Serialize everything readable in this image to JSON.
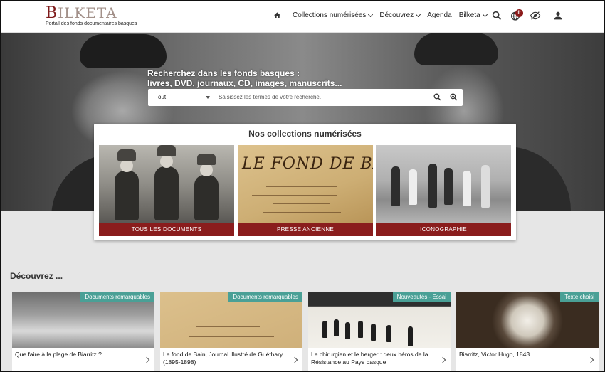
{
  "header": {
    "logo_word_initial": "B",
    "logo_word_rest": "ILKETA",
    "logo_subtitle": "Portail des fonds documentaires basques",
    "nav": [
      {
        "label": "Collections numérisées",
        "has_dropdown": true
      },
      {
        "label": "Découvrez",
        "has_dropdown": true
      },
      {
        "label": "Agenda",
        "has_dropdown": false
      },
      {
        "label": "Bilketa",
        "has_dropdown": true
      }
    ],
    "language_badge": "fr",
    "icons": [
      "home-icon",
      "search-icon",
      "globe-icon",
      "accessibility-eye-icon",
      "user-icon"
    ]
  },
  "hero": {
    "title_line1": "Recherchez dans les fonds basques :",
    "title_line2": "livres, DVD, journaux, CD, images, manuscrits...",
    "search": {
      "scope_value": "Tout",
      "placeholder": "Saisissez les termes de votre recherche."
    }
  },
  "collections": {
    "title": "Nos collections numérisées",
    "press_image_title": "LE FOND DE BAIN",
    "items": [
      {
        "label": "TOUS LES DOCUMENTS"
      },
      {
        "label": "PRESSE ANCIENNE"
      },
      {
        "label": "ICONOGRAPHIE"
      }
    ]
  },
  "discover": {
    "title": "Découvrez ...",
    "cards": [
      {
        "tag": "Documents remarquables",
        "caption": "Que faire à la plage de Biarritz ?"
      },
      {
        "tag": "Documents remarquables",
        "caption": "Le fond de Bain, Journal illustré de Guéthary (1895-1898)"
      },
      {
        "tag": "Nouveautés - Essai",
        "caption": "Le chirurgien et le berger : deux héros de la Résistance au Pays basque"
      },
      {
        "tag": "Texte choisi",
        "caption": "Biarritz, Victor Hugo, 1843"
      }
    ]
  },
  "colors": {
    "brand_red": "#8a1d1d",
    "tag_teal": "#4aa096",
    "logo_grey": "#a3918a"
  }
}
